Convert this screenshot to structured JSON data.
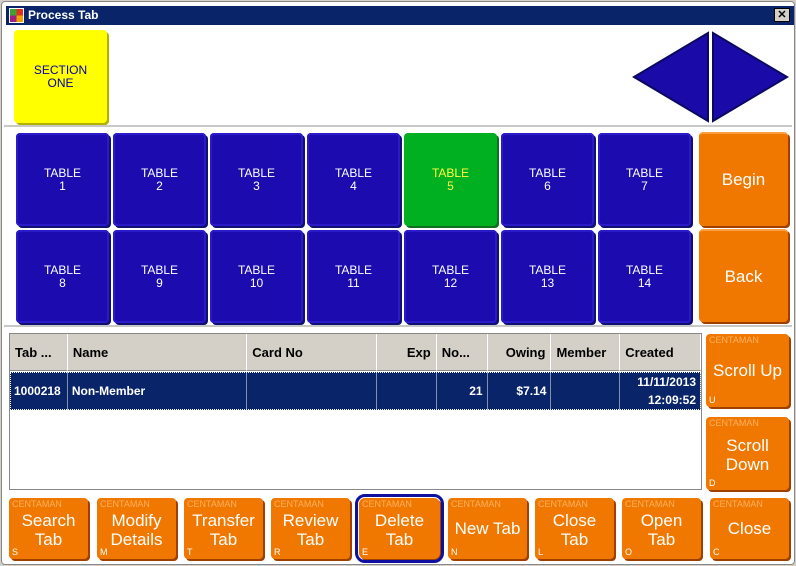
{
  "window": {
    "title": "Process Tab",
    "close": "✕"
  },
  "section": {
    "label": "SECTION\nONE"
  },
  "nav": {
    "prev": "previous-arrow",
    "next": "next-arrow"
  },
  "tables": [
    {
      "label": "TABLE\n1"
    },
    {
      "label": "TABLE\n2"
    },
    {
      "label": "TABLE\n3"
    },
    {
      "label": "TABLE\n4"
    },
    {
      "label": "TABLE\n5",
      "selected": true
    },
    {
      "label": "TABLE\n6"
    },
    {
      "label": "TABLE\n7"
    },
    {
      "label": "TABLE\n8"
    },
    {
      "label": "TABLE\n9"
    },
    {
      "label": "TABLE\n10"
    },
    {
      "label": "TABLE\n11"
    },
    {
      "label": "TABLE\n12"
    },
    {
      "label": "TABLE\n13"
    },
    {
      "label": "TABLE\n14"
    }
  ],
  "side": {
    "begin": "Begin",
    "back": "Back"
  },
  "list": {
    "columns": [
      "Tab ...",
      "Name",
      "Card No",
      "Exp",
      "No...",
      "Owing",
      "Member",
      "Created"
    ],
    "rows": [
      [
        "1000218",
        "Non-Member",
        "",
        "",
        "21",
        "$7.14",
        "",
        "11/11/2013\n12:09:52"
      ]
    ]
  },
  "scroll": [
    {
      "brand": "CENTAMAN",
      "label": "Scroll Up",
      "key": "U"
    },
    {
      "brand": "CENTAMAN",
      "label": "Scroll\nDown",
      "key": "D"
    }
  ],
  "actions": [
    {
      "brand": "CENTAMAN",
      "label": "Search\nTab",
      "key": "S"
    },
    {
      "brand": "CENTAMAN",
      "label": "Modify\nDetails",
      "key": "M"
    },
    {
      "brand": "CENTAMAN",
      "label": "Transfer\nTab",
      "key": "T"
    },
    {
      "brand": "CENTAMAN",
      "label": "Review\nTab",
      "key": "R"
    },
    {
      "brand": "CENTAMAN",
      "label": "Delete\nTab",
      "key": "E",
      "focused": true
    },
    {
      "brand": "CENTAMAN",
      "label": "New Tab",
      "key": "N"
    },
    {
      "brand": "CENTAMAN",
      "label": "Close\nTab",
      "key": "L"
    },
    {
      "brand": "CENTAMAN",
      "label": "Open\nTab",
      "key": "O"
    },
    {
      "brand": "CENTAMAN",
      "label": "Close",
      "key": "C"
    }
  ],
  "colors": {
    "titlebar": "#0a246a",
    "table": "#1c0cb0",
    "selected_table": "#00b020",
    "action": "#f07800",
    "section": "#ffff00"
  }
}
